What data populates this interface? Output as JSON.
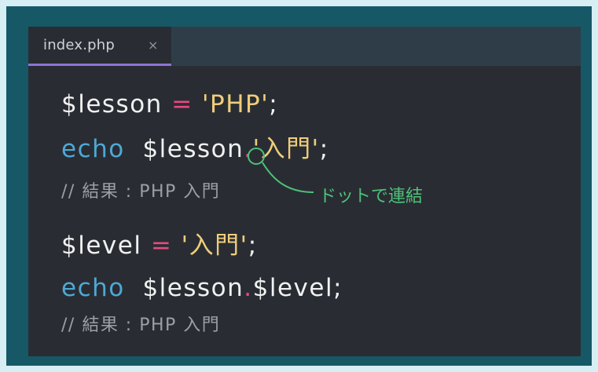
{
  "tab": {
    "label": "index.php",
    "close": "×"
  },
  "code": {
    "line1": {
      "var": "$lesson",
      "op": "=",
      "str": "'PHP'",
      "end": ";"
    },
    "line2": {
      "kw": "echo",
      "var": "$lesson",
      "dot": ".",
      "str": "'入門'",
      "end": ";"
    },
    "line3": {
      "comment": "// 結果 : PHP 入門"
    },
    "line4": {
      "var": "$level",
      "op": "=",
      "str": "'入門'",
      "end": ";"
    },
    "line5": {
      "kw": "echo",
      "var1": "$lesson",
      "dot": ".",
      "var2": "$level",
      "end": ";"
    },
    "line6": {
      "comment": "// 結果 : PHP 入門"
    }
  },
  "annotation": {
    "text": "ドットで連結"
  },
  "colors": {
    "background": "#d7eef4",
    "frame": "#175867",
    "editor": "#292d33",
    "tabbar": "#2f3d49",
    "tab_underline": "#8d74d8",
    "keyword": "#4ea8d6",
    "string": "#f0cd7b",
    "operator": "#e8497f",
    "comment": "#9aa0a6",
    "annotation": "#4fc17a"
  }
}
